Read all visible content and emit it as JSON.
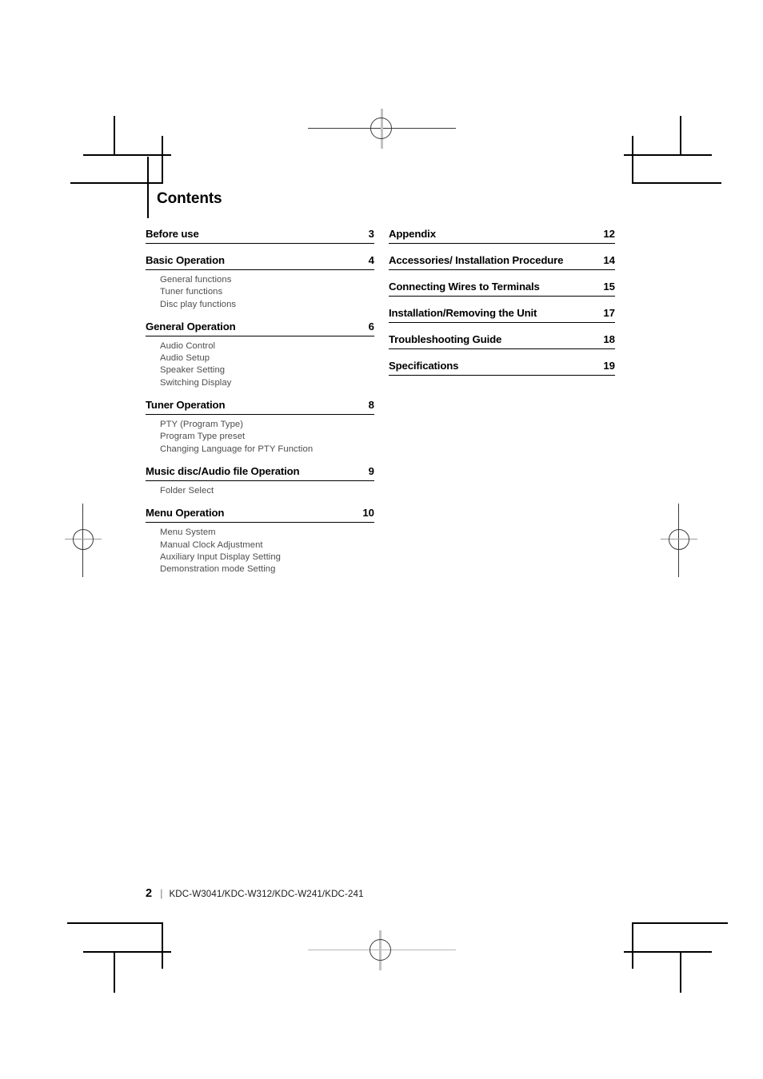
{
  "document": {
    "page_title": "Contents",
    "footer": {
      "page_number": "2",
      "separator": "|",
      "models": "KDC-W3041/KDC-W312/KDC-W241/KDC-241"
    }
  },
  "toc": {
    "left_column": [
      {
        "title": "Before use",
        "page": "3",
        "subitems": []
      },
      {
        "title": "Basic Operation",
        "page": "4",
        "subitems": [
          "General functions",
          "Tuner functions",
          "Disc play functions"
        ]
      },
      {
        "title": "General Operation",
        "page": "6",
        "subitems": [
          "Audio Control",
          "Audio Setup",
          "Speaker Setting",
          "Switching Display"
        ]
      },
      {
        "title": "Tuner Operation",
        "page": "8",
        "subitems": [
          "PTY (Program Type)",
          "Program Type preset",
          "Changing Language for PTY Function"
        ]
      },
      {
        "title": "Music disc/Audio file Operation",
        "page": "9",
        "subitems": [
          "Folder Select"
        ]
      },
      {
        "title": "Menu Operation",
        "page": "10",
        "subitems": [
          "Menu System",
          "Manual Clock Adjustment",
          "Auxiliary Input Display Setting",
          "Demonstration mode Setting"
        ]
      }
    ],
    "right_column": [
      {
        "title": "Appendix",
        "page": "12",
        "subitems": []
      },
      {
        "title": "Accessories/ Installation Procedure",
        "page": "14",
        "subitems": []
      },
      {
        "title": "Connecting Wires to Terminals",
        "page": "15",
        "subitems": []
      },
      {
        "title": "Installation/Removing the Unit",
        "page": "17",
        "subitems": []
      },
      {
        "title": "Troubleshooting Guide",
        "page": "18",
        "subitems": []
      },
      {
        "title": "Specifications",
        "page": "19",
        "subitems": []
      }
    ]
  },
  "print_marks": {
    "colors": {
      "crop_mark": "#000000",
      "registration_ring": "#3a3a3a",
      "registration_dark_line": "#3a3a3a",
      "registration_light_line": "#b0b0b0"
    },
    "corner_marks": [
      {
        "name": "crop-mark-top-left"
      },
      {
        "name": "crop-mark-top-right"
      },
      {
        "name": "crop-mark-bottom-left"
      },
      {
        "name": "crop-mark-bottom-right"
      }
    ],
    "registration_marks": [
      {
        "name": "registration-mark-top-center"
      },
      {
        "name": "registration-mark-bottom-center"
      },
      {
        "name": "registration-mark-left-middle"
      },
      {
        "name": "registration-mark-right-middle"
      }
    ]
  }
}
